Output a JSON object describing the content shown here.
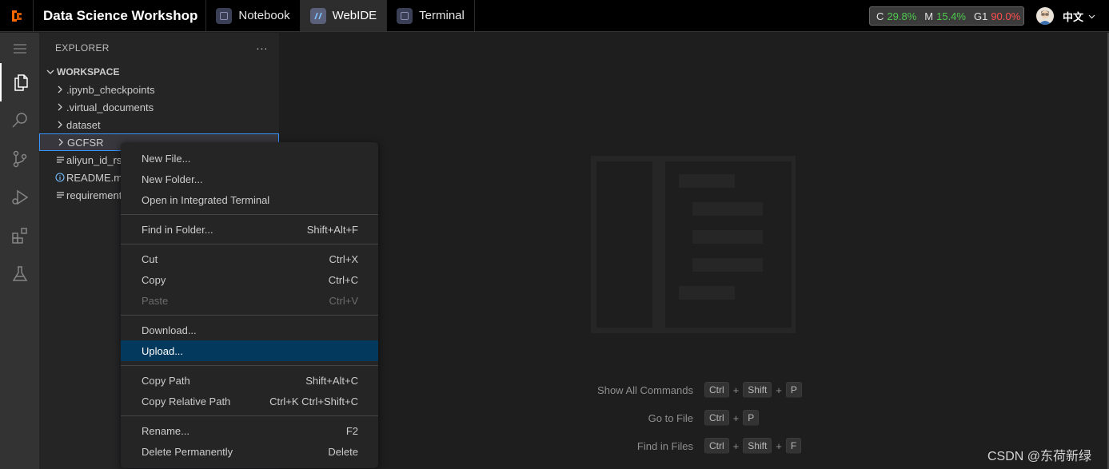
{
  "app": {
    "title": "Data Science Workshop"
  },
  "tabs": [
    {
      "label": "Notebook",
      "active": false
    },
    {
      "label": "WebIDE",
      "active": true
    },
    {
      "label": "Terminal",
      "active": false
    }
  ],
  "stats": {
    "c_label": "C",
    "c_value": "29.8%",
    "m_label": "M",
    "m_value": "15.4%",
    "g_label": "G1",
    "g_value": "90.0%"
  },
  "language": "中文",
  "sidebar": {
    "title": "EXPLORER",
    "more": "···",
    "workspace": "WORKSPACE",
    "items": [
      {
        "label": ".ipynb_checkpoints",
        "type": "folder"
      },
      {
        "label": ".virtual_documents",
        "type": "folder"
      },
      {
        "label": "dataset",
        "type": "folder"
      },
      {
        "label": "GCFSR",
        "type": "folder",
        "selected": true
      },
      {
        "label": "aliyun_id_rsa",
        "type": "file"
      },
      {
        "label": "README.md",
        "type": "info"
      },
      {
        "label": "requirements.txt",
        "type": "file"
      }
    ]
  },
  "context_menu": {
    "groups": [
      [
        {
          "label": "New File...",
          "shortcut": ""
        },
        {
          "label": "New Folder...",
          "shortcut": ""
        },
        {
          "label": "Open in Integrated Terminal",
          "shortcut": ""
        }
      ],
      [
        {
          "label": "Find in Folder...",
          "shortcut": "Shift+Alt+F"
        }
      ],
      [
        {
          "label": "Cut",
          "shortcut": "Ctrl+X"
        },
        {
          "label": "Copy",
          "shortcut": "Ctrl+C"
        },
        {
          "label": "Paste",
          "shortcut": "Ctrl+V",
          "disabled": true
        }
      ],
      [
        {
          "label": "Download...",
          "shortcut": ""
        },
        {
          "label": "Upload...",
          "shortcut": "",
          "highlighted": true
        }
      ],
      [
        {
          "label": "Copy Path",
          "shortcut": "Shift+Alt+C"
        },
        {
          "label": "Copy Relative Path",
          "shortcut": "Ctrl+K Ctrl+Shift+C"
        }
      ],
      [
        {
          "label": "Rename...",
          "shortcut": "F2"
        },
        {
          "label": "Delete Permanently",
          "shortcut": "Delete"
        }
      ]
    ]
  },
  "editor_hints": [
    {
      "label": "Show All Commands",
      "keys": [
        "Ctrl",
        "Shift",
        "P"
      ]
    },
    {
      "label": "Go to File",
      "keys": [
        "Ctrl",
        "P"
      ]
    },
    {
      "label": "Find in Files",
      "keys": [
        "Ctrl",
        "Shift",
        "F"
      ]
    }
  ],
  "watermark": "CSDN @东荷新绿",
  "colors": {
    "accent": "#3794ff",
    "menu_highlight": "#04395e",
    "stat_green": "#4ec94e",
    "stat_red": "#ff4d4d"
  }
}
